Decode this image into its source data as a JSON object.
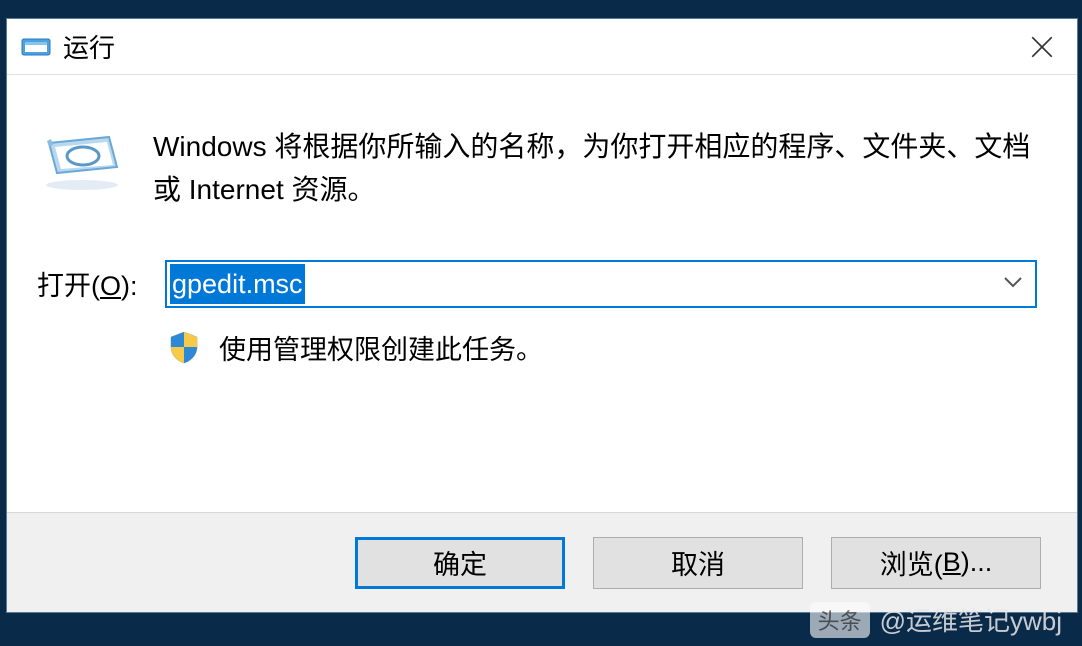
{
  "dialog": {
    "title": "运行",
    "description": "Windows 将根据你所输入的名称，为你打开相应的程序、文件夹、文档或 Internet 资源。",
    "input_label_prefix": "打开(",
    "input_label_hotkey": "O",
    "input_label_suffix": "):",
    "input_value": "gpedit.msc",
    "admin_notice": "使用管理权限创建此任务。"
  },
  "buttons": {
    "ok": "确定",
    "cancel": "取消",
    "browse_prefix": "浏览(",
    "browse_hotkey": "B",
    "browse_suffix": ")..."
  },
  "watermark": {
    "badge": "头条",
    "text": "@运维笔记ywbj"
  }
}
